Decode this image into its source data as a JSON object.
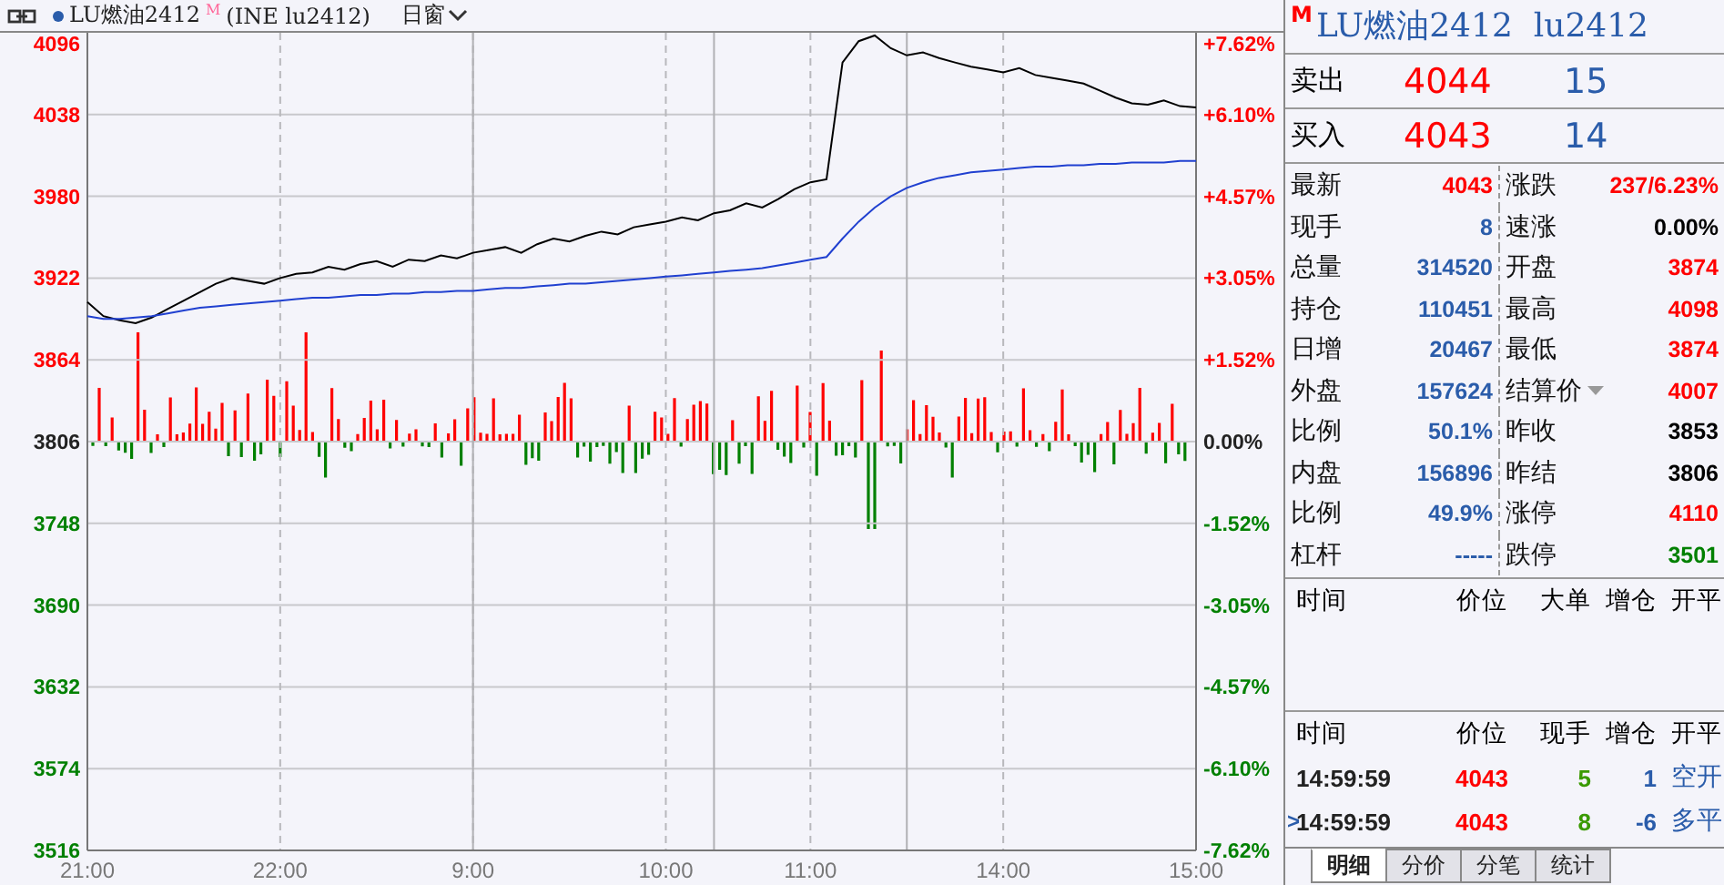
{
  "header": {
    "title": "LU燃油2412",
    "badge": "M",
    "subtitle": "(INE lu2412)",
    "period": "日窗"
  },
  "chart": {
    "chart_data": {
      "type": "line",
      "categories": [
        "21:00",
        null,
        null,
        null,
        null,
        null,
        null,
        null,
        null,
        null,
        null,
        null,
        "22:00",
        null,
        null,
        null,
        null,
        null,
        null,
        null,
        null,
        null,
        null,
        null,
        "9:00",
        null,
        null,
        null,
        null,
        null,
        null,
        null,
        null,
        null,
        null,
        null,
        "10:00",
        null,
        null,
        null,
        null,
        null,
        null,
        null,
        null,
        "11:00",
        null,
        null,
        null,
        null,
        null,
        null,
        null,
        null,
        null,
        null,
        null,
        "14:00",
        null,
        null,
        null,
        null,
        null,
        null,
        null,
        null,
        null,
        null,
        null,
        "15:00"
      ],
      "series": [
        {
          "color": "#000000",
          "values": [
            3905,
            3895,
            3892,
            3890,
            3894,
            3900,
            3906,
            3912,
            3918,
            3922,
            3920,
            3918,
            3922,
            3925,
            3926,
            3930,
            3928,
            3932,
            3934,
            3930,
            3935,
            3934,
            3938,
            3936,
            3940,
            3942,
            3944,
            3940,
            3946,
            3950,
            3948,
            3952,
            3955,
            3953,
            3958,
            3960,
            3962,
            3965,
            3963,
            3968,
            3970,
            3975,
            3972,
            3978,
            3985,
            3990,
            3992,
            4075,
            4090,
            4094,
            4085,
            4080,
            4082,
            4078,
            4075,
            4072,
            4070,
            4068,
            4071,
            4066,
            4064,
            4062,
            4060,
            4055,
            4050,
            4046,
            4045,
            4048,
            4044,
            4043
          ]
        },
        {
          "color": "#2040d0",
          "values": [
            3895,
            3893,
            3893,
            3894,
            3895,
            3897,
            3899,
            3901,
            3902,
            3903,
            3904,
            3905,
            3906,
            3907,
            3908,
            3908,
            3909,
            3910,
            3910,
            3911,
            3911,
            3912,
            3912,
            3913,
            3913,
            3914,
            3915,
            3915,
            3916,
            3917,
            3918,
            3918,
            3919,
            3920,
            3921,
            3922,
            3923,
            3924,
            3925,
            3926,
            3927,
            3928,
            3929,
            3931,
            3933,
            3935,
            3937,
            3950,
            3962,
            3972,
            3980,
            3986,
            3990,
            3993,
            3995,
            3997,
            3998,
            3999,
            4000,
            4001,
            4001,
            4002,
            4002,
            4003,
            4003,
            4004,
            4004,
            4004,
            4005,
            4005
          ]
        }
      ],
      "ylim": [
        3516,
        4096
      ],
      "grid": true,
      "yticks": [
        {
          "value": 4096,
          "label": "4096"
        },
        {
          "value": 4038,
          "label": "4038"
        },
        {
          "value": 3980,
          "label": "3980"
        },
        {
          "value": 3922,
          "label": "3922"
        },
        {
          "value": 3864,
          "label": "3864"
        },
        {
          "value": 3806,
          "label": "3806"
        },
        {
          "value": 3748,
          "label": "3748"
        },
        {
          "value": 3690,
          "label": "3690"
        },
        {
          "value": 3632,
          "label": "3632"
        },
        {
          "value": 3574,
          "label": "3574"
        },
        {
          "value": 3516,
          "label": "3516"
        }
      ]
    },
    "right_ticks": [
      "+7.62%",
      "+6.10%",
      "+4.57%",
      "+3.05%",
      "+1.52%",
      "0.00%",
      "-1.52%",
      "-3.05%",
      "-4.57%",
      "-6.10%",
      "-7.62%"
    ]
  },
  "quote": {
    "badge": "M",
    "title": "LU燃油2412  lu2412",
    "book": [
      {
        "label": "卖出",
        "price": "4044",
        "volume": "15"
      },
      {
        "label": "买入",
        "price": "4043",
        "volume": "14"
      }
    ],
    "stats": [
      {
        "left": {
          "label": "最新",
          "value": "4043",
          "color": "#ff0000"
        },
        "right": {
          "label": "涨跌",
          "value": "237/6.23%",
          "color": "#ff0000",
          "menu": false
        }
      },
      {
        "left": {
          "label": "现手",
          "value": "8",
          "color": "#2a5caa"
        },
        "right": {
          "label": "速涨",
          "value": "0.00%",
          "color": "#000000",
          "menu": false
        }
      },
      {
        "left": {
          "label": "总量",
          "value": "314520",
          "color": "#2a5caa"
        },
        "right": {
          "label": "开盘",
          "value": "3874",
          "color": "#ff0000",
          "menu": false
        }
      },
      {
        "left": {
          "label": "持仓",
          "value": "110451",
          "color": "#2a5caa"
        },
        "right": {
          "label": "最高",
          "value": "4098",
          "color": "#ff0000",
          "menu": false
        }
      },
      {
        "left": {
          "label": "日增",
          "value": "20467",
          "color": "#2a5caa"
        },
        "right": {
          "label": "最低",
          "value": "3874",
          "color": "#ff0000",
          "menu": false
        }
      },
      {
        "left": {
          "label": "外盘",
          "value": "157624",
          "color": "#2a5caa"
        },
        "right": {
          "label": "结算价",
          "value": "4007",
          "color": "#ff0000",
          "menu": true
        }
      },
      {
        "left": {
          "label": "比例",
          "value": "50.1%",
          "color": "#2a5caa"
        },
        "right": {
          "label": "昨收",
          "value": "3853",
          "color": "#000000",
          "menu": false
        }
      },
      {
        "left": {
          "label": "内盘",
          "value": "156896",
          "color": "#2a5caa"
        },
        "right": {
          "label": "昨结",
          "value": "3806",
          "color": "#000000",
          "menu": false
        }
      },
      {
        "left": {
          "label": "比例",
          "value": "49.9%",
          "color": "#2a5caa"
        },
        "right": {
          "label": "涨停",
          "value": "4110",
          "color": "#ff0000",
          "menu": false
        }
      },
      {
        "left": {
          "label": "杠杆",
          "value": "-----",
          "color": "#2a5caa"
        },
        "right": {
          "label": "跌停",
          "value": "3501",
          "color": "#008000",
          "menu": false
        }
      }
    ],
    "big_orders": {
      "columns": [
        "时间",
        "价位",
        "大单",
        "增仓",
        "开平"
      ]
    },
    "ticks": {
      "columns": [
        "时间",
        "价位",
        "现手",
        "增仓",
        "开平"
      ],
      "pointer": ">",
      "rows": [
        {
          "selected": false,
          "time": "14:59:59",
          "price": "4043",
          "volume": "5",
          "change": "1",
          "type": "空开"
        },
        {
          "selected": true,
          "time": "14:59:59",
          "price": "4043",
          "volume": "8",
          "change": "-6",
          "type": "多平"
        }
      ]
    },
    "tabs": [
      {
        "label": "明细",
        "selected": true
      },
      {
        "label": "分价",
        "selected": false
      },
      {
        "label": "分笔",
        "selected": false
      },
      {
        "label": "统计",
        "selected": false
      }
    ]
  }
}
